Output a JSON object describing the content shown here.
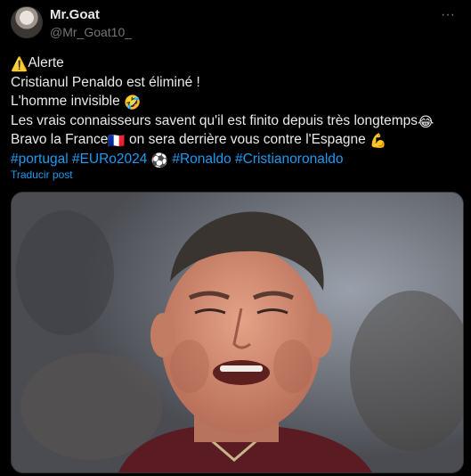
{
  "author": {
    "display_name": "Mr.Goat",
    "handle": "@Mr_Goat10_",
    "more_glyph": "···"
  },
  "post": {
    "line1_text": "Alerte",
    "line2": "Cristianul Penaldo est éliminé !",
    "line3_text": "L'homme invisible ",
    "line4_text": "Les vrais connaisseurs savent qu'il est finito depuis très longtemps",
    "line5_text_a": "Bravo la France",
    "line5_text_b": " on sera derrière vous contre l'Espagne ",
    "hashtags": [
      "#portugal",
      "#EURo2024",
      "#Ronaldo",
      "#Cristianoronaldo"
    ],
    "emoji": {
      "warning": "⚠️",
      "rofl": "🤣",
      "joy": "😂",
      "france_flag": "🇫🇷",
      "muscle": "💪",
      "football": "⚽"
    }
  },
  "translate_link": "Traducir post",
  "media": {
    "icon": "photo-icon",
    "colors": {
      "skin": "#d48e74",
      "hair": "#3a3430",
      "shirt": "#5a1c22",
      "background": "#6c6f77"
    }
  }
}
